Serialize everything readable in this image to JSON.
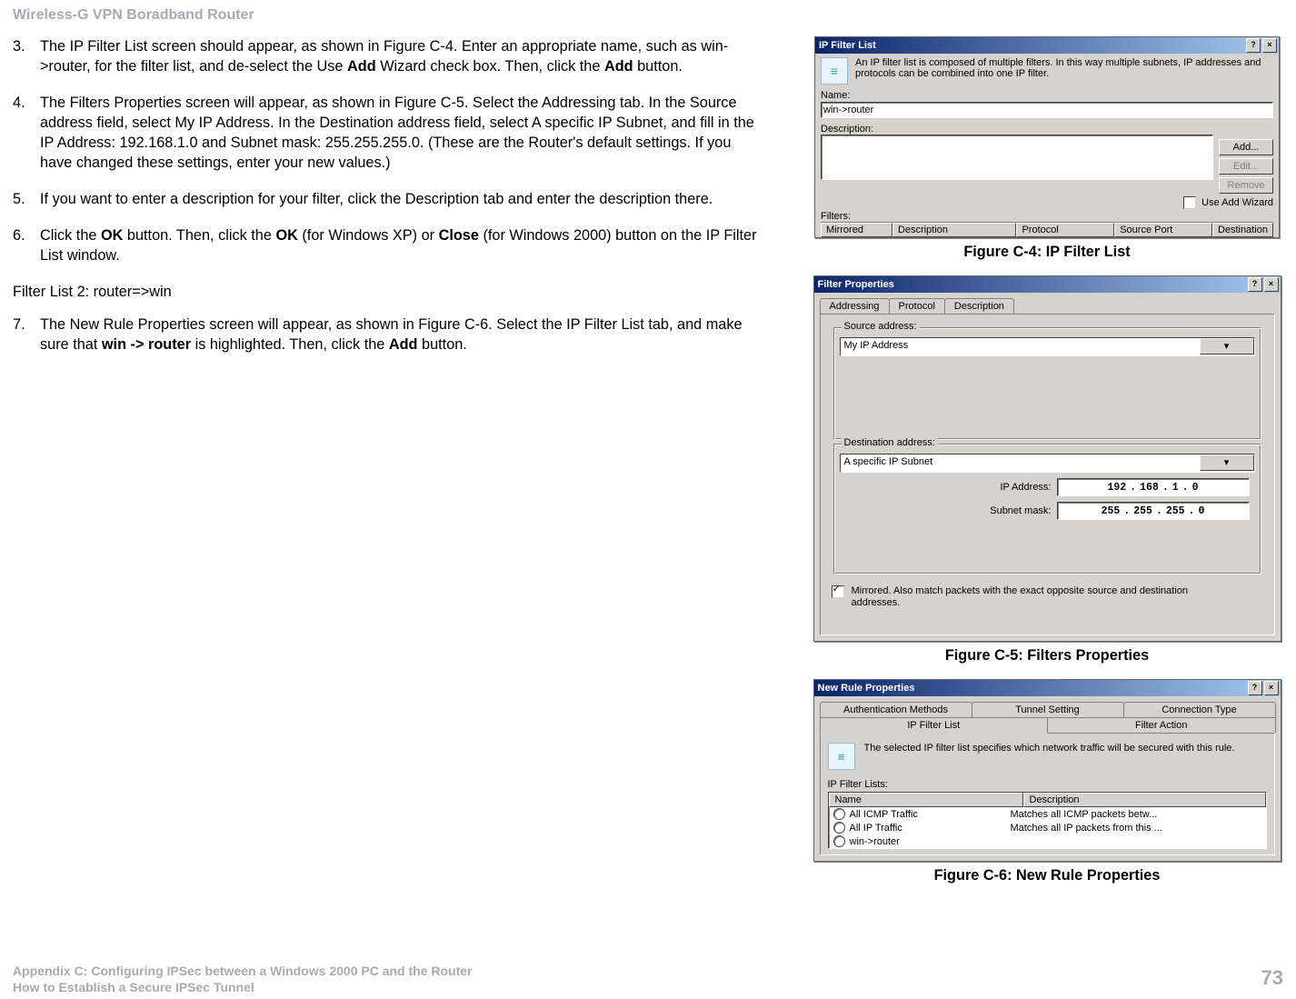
{
  "page": {
    "running_header": "Wireless-G VPN Boradband Router",
    "footer_line1": "Appendix C: Configuring IPSec between a Windows 2000 PC and the Router",
    "footer_line2": "How to Establish a Secure IPSec Tunnel",
    "page_number": "73"
  },
  "text": {
    "step3_a": "The IP Filter List screen should appear, as shown in Figure C-4. Enter an appropriate name, such as win->router, for the filter list, and de-select the Use ",
    "step3_b": " Wizard check box. Then, click the ",
    "step3_c": " button.",
    "add_word": "Add",
    "step4": "The Filters Properties screen will appear, as shown in Figure C-5. Select the Addressing tab. In the Source address field, select My IP Address. In the Destination address field, select A specific IP Subnet, and fill in the IP Address: 192.168.1.0 and Subnet mask: 255.255.255.0. (These are the Router's default settings. If you have changed these settings, enter your new values.)",
    "step5": "If you want to enter a description for your filter, click the Description tab and enter the description there.",
    "step6_a": "Click the ",
    "step6_b": " button. Then, click the ",
    "step6_c": " (for Windows XP) or ",
    "step6_d": " (for Windows 2000) button on the IP Filter List window.",
    "ok_word": "OK",
    "close_word": "Close",
    "filter_list_2_heading": "Filter List 2: router=>win",
    "step7_a": "The New Rule Properties screen will appear, as shown in Figure C-6. Select the IP Filter List tab, and make sure that ",
    "step7_b": " is highlighted. Then, click the ",
    "step7_c": " button.",
    "win_router": "win -> router"
  },
  "captions": {
    "c4": "Figure C-4: IP Filter List",
    "c5": "Figure C-5: Filters Properties",
    "c6": "Figure C-6: New Rule Properties"
  },
  "fig_c4": {
    "title": "IP Filter List",
    "intro": "An IP filter list is composed of multiple filters. In this way multiple subnets, IP addresses and protocols can be combined into one IP filter.",
    "name_label": "Name:",
    "name_value": "win->router",
    "desc_label": "Description:",
    "btn_add": "Add...",
    "btn_edit": "Edit...",
    "btn_remove": "Remove",
    "use_add_wizard": "Use Add Wizard",
    "filters_label": "Filters:",
    "cols": [
      "Mirrored",
      "Description",
      "Protocol",
      "Source Port",
      "Destination"
    ]
  },
  "fig_c5": {
    "title": "Filter Properties",
    "tabs": [
      "Addressing",
      "Protocol",
      "Description"
    ],
    "src_label": "Source address:",
    "src_value": "My IP Address",
    "dst_label": "Destination address:",
    "dst_value": "A specific IP Subnet",
    "ip_label": "IP Address:",
    "ip_octets": [
      "192",
      "168",
      "1",
      "0"
    ],
    "mask_label": "Subnet mask:",
    "mask_octets": [
      "255",
      "255",
      "255",
      "0"
    ],
    "mirror_text": "Mirrored. Also match packets with the exact opposite source and destination addresses."
  },
  "fig_c6": {
    "title": "New Rule Properties",
    "tabs_row1": [
      "Authentication Methods",
      "Tunnel Setting",
      "Connection Type"
    ],
    "tabs_row2": [
      "IP Filter List",
      "Filter Action"
    ],
    "intro": "The selected IP filter list specifies which network traffic will be secured with this rule.",
    "lists_label": "IP Filter Lists:",
    "cols": [
      "Name",
      "Description"
    ],
    "rows": [
      {
        "name": "All ICMP Traffic",
        "desc": "Matches all ICMP packets betw..."
      },
      {
        "name": "All IP Traffic",
        "desc": "Matches all IP packets from this ..."
      },
      {
        "name": "win->router",
        "desc": ""
      }
    ]
  }
}
